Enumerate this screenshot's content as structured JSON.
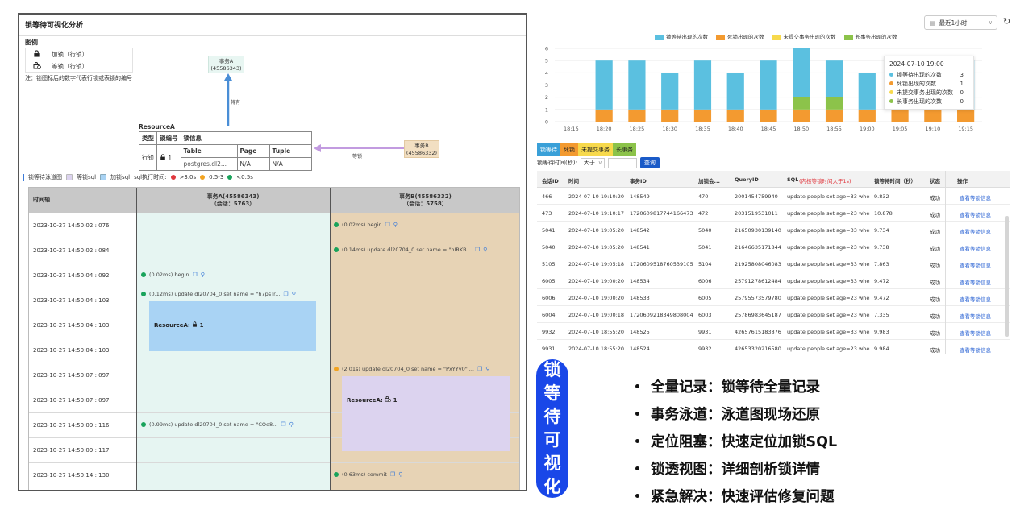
{
  "left": {
    "title": "锁等待可视化分析",
    "legend_heading": "图例",
    "legend": [
      {
        "icon": "lock-icon",
        "label": "加锁（行锁）"
      },
      {
        "icon": "wait-lock-icon",
        "label": "等锁（行锁）"
      }
    ],
    "legend_note": "注：锁图标后的数字代表行锁或表锁的编号",
    "graph": {
      "node_a": {
        "line1": "事务A",
        "line2": "(45586343)"
      },
      "node_b": {
        "line1": "事务B",
        "line2": "(45586332)"
      },
      "edge_hold": "持有",
      "edge_wait": "等锁"
    },
    "resource": {
      "title": "ResourceA",
      "header": [
        "类型",
        "锁编号",
        "锁信息"
      ],
      "type": "行锁",
      "lock_no": "1",
      "info_header": [
        "Table",
        "Page",
        "Tuple"
      ],
      "info_values": [
        "postgres.dl2...",
        "N/A",
        "N/A"
      ]
    },
    "swim_legend": {
      "label": "锁等待泳道图",
      "wait_sql": "等锁sql",
      "lock_sql": "加锁sql",
      "exec_label": "sql执行时间:",
      "gt3": ">3.0s",
      "mid": "0.5-3",
      "lt05": "<0.5s"
    },
    "swim": {
      "col_time": "时间轴",
      "col_a": {
        "line1": "事务A(45586343)",
        "line2": "（会话：5763）"
      },
      "col_b": {
        "line1": "事务B(45586332)",
        "line2": "（会话：5758）"
      },
      "rows": [
        "2023-10-27 14:50:02 : 076",
        "2023-10-27 14:50:02 : 084",
        "2023-10-27 14:50:04 : 092",
        "2023-10-27 14:50:04 : 103",
        "2023-10-27 14:50:04 : 103",
        "2023-10-27 14:50:04 : 103",
        "2023-10-27 14:50:07 : 097",
        "2023-10-27 14:50:07 : 097",
        "2023-10-27 14:50:09 : 116",
        "2023-10-27 14:50:09 : 117",
        "2023-10-27 14:50:14 : 130"
      ],
      "events": {
        "b0": "(0.02ms) begin",
        "b1": "(0.14ms) update dl20704_0 set name = \"hIRKB...",
        "a2": "(0.02ms) begin",
        "a3": "(0.12ms) update dl20704_0 set name = \"h7psTr...",
        "b6": "(2.01s) update dl20704_0 set name = \"PxYYv0\" ...",
        "a8": "(0.99ms) update dl20704_0 set name = \"COe8...",
        "b10": "(0.63ms) commit"
      },
      "lockbox_a": "ResourceA:",
      "lockbox_a_no": "1",
      "lockbox_b": "ResourceA:",
      "lockbox_b_no": "1"
    }
  },
  "chart_panel": {
    "time_select": "最近1小时",
    "tooltip": {
      "title": "2024-07-10 19:00",
      "items": [
        {
          "label": "锁等待出现的次数",
          "value": "3",
          "color": "#5bc0e0"
        },
        {
          "label": "死锁出现的次数",
          "value": "1",
          "color": "#f39a30"
        },
        {
          "label": "未提交事务出现的次数",
          "value": "0",
          "color": "#f7d94c"
        },
        {
          "label": "长事务出现的次数",
          "value": "0",
          "color": "#8cc34a"
        }
      ]
    }
  },
  "chart_data": {
    "type": "bar",
    "stacked": true,
    "categories": [
      "18:15",
      "18:20",
      "18:25",
      "18:30",
      "18:35",
      "18:40",
      "18:45",
      "18:50",
      "18:55",
      "19:00",
      "19:05",
      "19:10",
      "19:15"
    ],
    "series": [
      {
        "name": "锁等待出现的次数",
        "color": "#5bc0e0",
        "values": [
          0,
          4,
          4,
          3,
          4,
          3,
          4,
          4,
          3,
          3,
          4,
          4,
          4
        ]
      },
      {
        "name": "死锁出现的次数",
        "color": "#f39a30",
        "values": [
          0,
          1,
          1,
          1,
          1,
          1,
          1,
          1,
          1,
          1,
          1,
          1,
          1
        ]
      },
      {
        "name": "未提交事务出现的次数",
        "color": "#f7d94c",
        "values": [
          0,
          0,
          0,
          0,
          0,
          0,
          0,
          0,
          0,
          0,
          0,
          0,
          0
        ]
      },
      {
        "name": "长事务出现的次数",
        "color": "#8cc34a",
        "values": [
          0,
          0,
          0,
          0,
          0,
          0,
          0,
          1,
          1,
          0,
          0,
          0,
          0
        ]
      }
    ],
    "ylim": [
      0,
      6
    ],
    "yticks": [
      0,
      1,
      2,
      3,
      4,
      5,
      6
    ],
    "legend": "top",
    "grid": true
  },
  "table_panel": {
    "tabs": [
      "锁等待",
      "死锁",
      "未提交事务",
      "长事务"
    ],
    "filter_label": "锁等待时间(秒):",
    "filter_op": "大于",
    "filter_value": "",
    "query_button": "查询",
    "headers": [
      "会话ID",
      "时间",
      "事务ID",
      "加锁会...",
      "QueryID",
      "SQL",
      "(内核等锁时间大于1s)",
      "锁等待时间（秒）",
      "状态",
      "操作"
    ],
    "rows": [
      [
        "466",
        "2024-07-10 19:10:20",
        "148549",
        "470",
        "2001454759940",
        "update people set age=33 where",
        "9.832",
        "成功",
        "查看等锁信息"
      ],
      [
        "473",
        "2024-07-10 19:10:17",
        "1720609817744166473",
        "472",
        "2031519531011",
        "update people set age=23 where",
        "10.878",
        "成功",
        "查看等锁信息"
      ],
      [
        "5041",
        "2024-07-10 19:05:20",
        "148542",
        "5040",
        "21650930139140",
        "update people set age=33 where",
        "9.734",
        "成功",
        "查看等锁信息"
      ],
      [
        "5040",
        "2024-07-10 19:05:20",
        "148541",
        "5041",
        "21646635171844",
        "update people set age=23 where",
        "9.738",
        "成功",
        "查看等锁信息"
      ],
      [
        "5105",
        "2024-07-10 19:05:18",
        "1720609518760539105",
        "5104",
        "21925808046083",
        "update people set age=33 where",
        "7.863",
        "成功",
        "查看等锁信息"
      ],
      [
        "6005",
        "2024-07-10 19:00:20",
        "148534",
        "6006",
        "25791278612484",
        "update people set age=33 where",
        "9.472",
        "成功",
        "查看等锁信息"
      ],
      [
        "6006",
        "2024-07-10 19:00:20",
        "148533",
        "6005",
        "25795573579780",
        "update people set age=23 where",
        "9.472",
        "成功",
        "查看等锁信息"
      ],
      [
        "6004",
        "2024-07-10 19:00:18",
        "1720609218349808004",
        "6003",
        "25786983645187",
        "update people set age=23 where",
        "7.335",
        "成功",
        "查看等锁信息"
      ],
      [
        "9932",
        "2024-07-10 18:55:20",
        "148525",
        "9931",
        "42657615183876",
        "update people set age=33 where",
        "9.983",
        "成功",
        "查看等锁信息"
      ],
      [
        "9931",
        "2024-07-10 18:55:20",
        "148524",
        "9932",
        "42653320216580",
        "update people set age=23 where",
        "9.984",
        "成功",
        "查看等锁信息"
      ]
    ]
  },
  "badge": [
    "锁",
    "等",
    "待",
    "可",
    "视",
    "化"
  ],
  "bullets": [
    "全量记录：锁等待全量记录",
    "事务泳道：泳道图现场还原",
    "定位阻塞：快速定位加锁SQL",
    "锁透视图：详细剖析锁详情",
    "紧急解决：快速评估修复问题"
  ]
}
